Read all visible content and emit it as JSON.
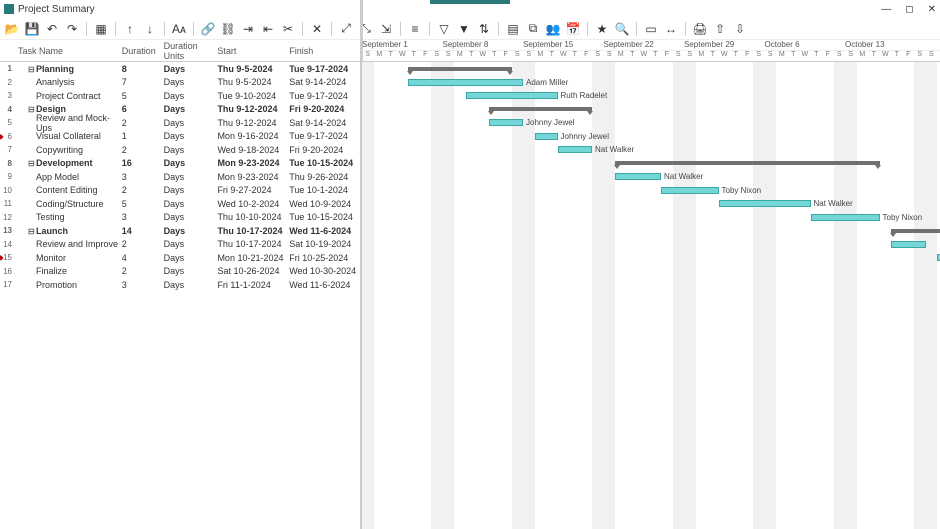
{
  "window": {
    "title": "Project Summary",
    "minimize": "—",
    "maximize": "◻",
    "close": "✕"
  },
  "toolbar": {
    "items": [
      "open",
      "save",
      "undo",
      "redo",
      "",
      "grid",
      "",
      "arrow-up",
      "arrow-down",
      "",
      "font",
      "",
      "link",
      "unlink",
      "indent",
      "outdent",
      "cut",
      "",
      "delete",
      "",
      "zoom-in",
      "zoom-out",
      "goto",
      "",
      "align",
      "",
      "filter-clear",
      "filter",
      "sort",
      "",
      "gantt",
      "resources",
      "people",
      "calendar",
      "",
      "find",
      "zoom",
      "",
      "fit",
      "width",
      "",
      "print",
      "export",
      "import"
    ],
    "glyphs": {
      "open": "📂",
      "save": "💾",
      "undo": "↶",
      "redo": "↷",
      "grid": "▦",
      "arrow-up": "↑",
      "arrow-down": "↓",
      "font": "Aᴀ",
      "link": "🔗",
      "unlink": "⛓",
      "indent": "⇥",
      "outdent": "⇤",
      "cut": "✂",
      "delete": "✕",
      "zoom-in": "⤢",
      "zoom-out": "⤡",
      "goto": "⇲",
      "align": "≡",
      "filter-clear": "▽",
      "filter": "▼",
      "sort": "⇅",
      "gantt": "▤",
      "resources": "⧉",
      "people": "👥",
      "calendar": "📅",
      "find": "★",
      "zoom": "🔍",
      "fit": "▭",
      "width": "↔",
      "print": "🖨",
      "export": "⇧",
      "import": "⇩"
    }
  },
  "columns": {
    "task": "Task Name",
    "duration": "Duration",
    "durationUnits": "Duration Units",
    "start": "Start",
    "finish": "Finish"
  },
  "rows": [
    {
      "n": 1,
      "lvl": 1,
      "bold": true,
      "task": "Planning",
      "dur": "8",
      "du": "Days",
      "start": "Thu 9-5-2024",
      "finish": "Tue 9-17-2024",
      "type": "summary",
      "s": 4,
      "e": 12
    },
    {
      "n": 2,
      "lvl": 2,
      "task": "Ananlysis",
      "dur": "7",
      "du": "Days",
      "start": "Thu 9-5-2024",
      "finish": "Sat 9-14-2024",
      "type": "task",
      "s": 4,
      "e": 13,
      "res": "Adam Miller"
    },
    {
      "n": 3,
      "lvl": 2,
      "task": "Project Contract",
      "dur": "5",
      "du": "Days",
      "start": "Tue 9-10-2024",
      "finish": "Tue 9-17-2024",
      "type": "task",
      "s": 9,
      "e": 16,
      "res": "Ruth Radelet"
    },
    {
      "n": 4,
      "lvl": 1,
      "bold": true,
      "task": "Design",
      "dur": "6",
      "du": "Days",
      "start": "Thu 9-12-2024",
      "finish": "Fri 9-20-2024",
      "type": "summary",
      "s": 11,
      "e": 19
    },
    {
      "n": 5,
      "lvl": 2,
      "task": "Review and Mock-Ups",
      "dur": "2",
      "du": "Days",
      "start": "Thu 9-12-2024",
      "finish": "Sat 9-14-2024",
      "type": "task",
      "s": 11,
      "e": 13,
      "res": "Johnny Jewel"
    },
    {
      "n": 6,
      "lvl": 2,
      "alert": true,
      "task": "Visual Collateral",
      "dur": "1",
      "du": "Days",
      "start": "Mon 9-16-2024",
      "finish": "Tue 9-17-2024",
      "type": "task",
      "s": 15,
      "e": 16,
      "res": "Johnny Jewel"
    },
    {
      "n": 7,
      "lvl": 2,
      "task": "Copywriting",
      "dur": "2",
      "du": "Days",
      "start": "Wed 9-18-2024",
      "finish": "Fri 9-20-2024",
      "type": "task",
      "s": 17,
      "e": 19,
      "res": "Nat Walker"
    },
    {
      "n": 8,
      "lvl": 1,
      "bold": true,
      "task": "Development",
      "dur": "16",
      "du": "Days",
      "start": "Mon 9-23-2024",
      "finish": "Tue 10-15-2024",
      "type": "summary",
      "s": 22,
      "e": 44
    },
    {
      "n": 9,
      "lvl": 2,
      "task": "App Model",
      "dur": "3",
      "du": "Days",
      "start": "Mon 9-23-2024",
      "finish": "Thu 9-26-2024",
      "type": "task",
      "s": 22,
      "e": 25,
      "res": "Nat Walker"
    },
    {
      "n": 10,
      "lvl": 2,
      "task": "Content Editing",
      "dur": "2",
      "du": "Days",
      "start": "Fri 9-27-2024",
      "finish": "Tue 10-1-2024",
      "type": "task",
      "s": 26,
      "e": 30,
      "res": "Toby Nixon"
    },
    {
      "n": 11,
      "lvl": 2,
      "task": "Coding/Structure",
      "dur": "5",
      "du": "Days",
      "start": "Wed 10-2-2024",
      "finish": "Wed 10-9-2024",
      "type": "task",
      "s": 31,
      "e": 38,
      "res": "Nat Walker"
    },
    {
      "n": 12,
      "lvl": 2,
      "task": "Testing",
      "dur": "3",
      "du": "Days",
      "start": "Thu 10-10-2024",
      "finish": "Tue 10-15-2024",
      "type": "task",
      "s": 39,
      "e": 44,
      "res": "Toby Nixon"
    },
    {
      "n": 13,
      "lvl": 1,
      "bold": true,
      "task": "Launch",
      "dur": "14",
      "du": "Days",
      "start": "Thu 10-17-2024",
      "finish": "Wed 11-6-2024",
      "type": "summary",
      "s": 46,
      "e": 66
    },
    {
      "n": 14,
      "lvl": 2,
      "task": "Review and Improve",
      "dur": "2",
      "du": "Days",
      "start": "Thu 10-17-2024",
      "finish": "Sat 10-19-2024",
      "type": "task",
      "s": 46,
      "e": 48
    },
    {
      "n": 15,
      "lvl": 2,
      "alert": true,
      "task": "Monitor",
      "dur": "4",
      "du": "Days",
      "start": "Mon 10-21-2024",
      "finish": "Fri 10-25-2024",
      "type": "task",
      "s": 50,
      "e": 54
    },
    {
      "n": 16,
      "lvl": 2,
      "task": "Finalize",
      "dur": "2",
      "du": "Days",
      "start": "Sat 10-26-2024",
      "finish": "Wed 10-30-2024",
      "type": "task",
      "s": 55,
      "e": 59
    },
    {
      "n": 17,
      "lvl": 2,
      "task": "Promotion",
      "dur": "3",
      "du": "Days",
      "start": "Fri 11-1-2024",
      "finish": "Wed 11-6-2024",
      "type": "task",
      "s": 61,
      "e": 66
    }
  ],
  "timeline": {
    "dayWidth": 11.5,
    "startOffsetDays": 0,
    "weeks": [
      "September 1",
      "September 8",
      "September 15",
      "September 22",
      "September 29",
      "October 6",
      "October 13"
    ],
    "dayLetters": [
      "S",
      "M",
      "T",
      "W",
      "T",
      "F",
      "S"
    ]
  }
}
